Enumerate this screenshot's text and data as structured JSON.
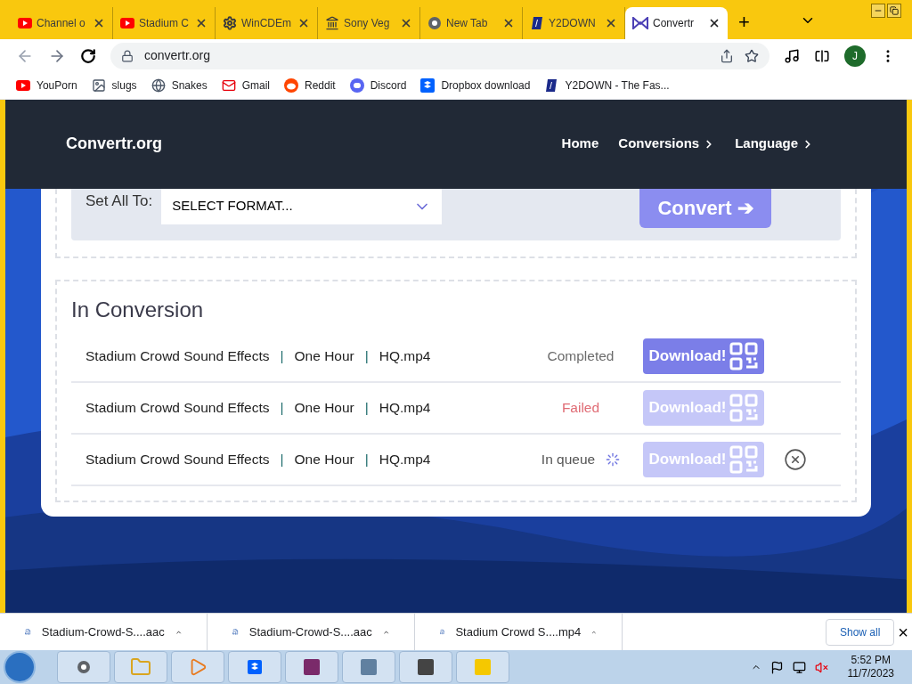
{
  "browser": {
    "tabs": [
      {
        "label": "Channel o",
        "selected": false
      },
      {
        "label": "Stadium C",
        "selected": false
      },
      {
        "label": "WinCDEm",
        "selected": false
      },
      {
        "label": "Sony Veg",
        "selected": false
      },
      {
        "label": "New Tab",
        "selected": false
      },
      {
        "label": "Y2DOWN",
        "selected": false
      },
      {
        "label": "Convertr",
        "selected": true
      }
    ],
    "new_tab": "+",
    "url": "convertr.org",
    "profile": "J",
    "bookmarks": [
      "YouPorn",
      "slugs",
      "Snakes",
      "Gmail",
      "Reddit",
      "Discord",
      "Dropbox download",
      "Y2DOWN - The Fas..."
    ]
  },
  "site": {
    "logo": "Convertr.org",
    "nav": [
      {
        "label": "Home",
        "chevron": false
      },
      {
        "label": "Conversions",
        "chevron": true
      },
      {
        "label": "Language",
        "chevron": true
      }
    ],
    "set_all_label": "Set All To:",
    "format_select": "SELECT FORMAT...",
    "convert_button": "Convert ➔",
    "section_title": "In Conversion",
    "rows": [
      {
        "parts": [
          "Stadium Crowd Sound Effects",
          "One Hour",
          "HQ.mp4"
        ],
        "separator": "|",
        "status": "Completed",
        "kind": "completed",
        "download": "Download!",
        "disabled": false,
        "cancellable": false
      },
      {
        "parts": [
          "Stadium Crowd Sound Effects",
          "One Hour",
          "HQ.mp4"
        ],
        "separator": "|",
        "status": "Failed",
        "kind": "failed",
        "download": "Download!",
        "disabled": true,
        "cancellable": false
      },
      {
        "parts": [
          "Stadium Crowd Sound Effects",
          "One Hour",
          "HQ.mp4"
        ],
        "separator": "|",
        "status": "In queue",
        "kind": "queued",
        "download": "Download!",
        "disabled": true,
        "cancellable": true
      }
    ]
  },
  "downloads": {
    "items": [
      "Stadium-Crowd-S....aac",
      "Stadium-Crowd-S....aac",
      "Stadium Crowd S....mp4"
    ],
    "show_all": "Show all",
    "close": "×"
  },
  "taskbar": {
    "time": "5:52 PM",
    "date": "11/7/2023"
  }
}
